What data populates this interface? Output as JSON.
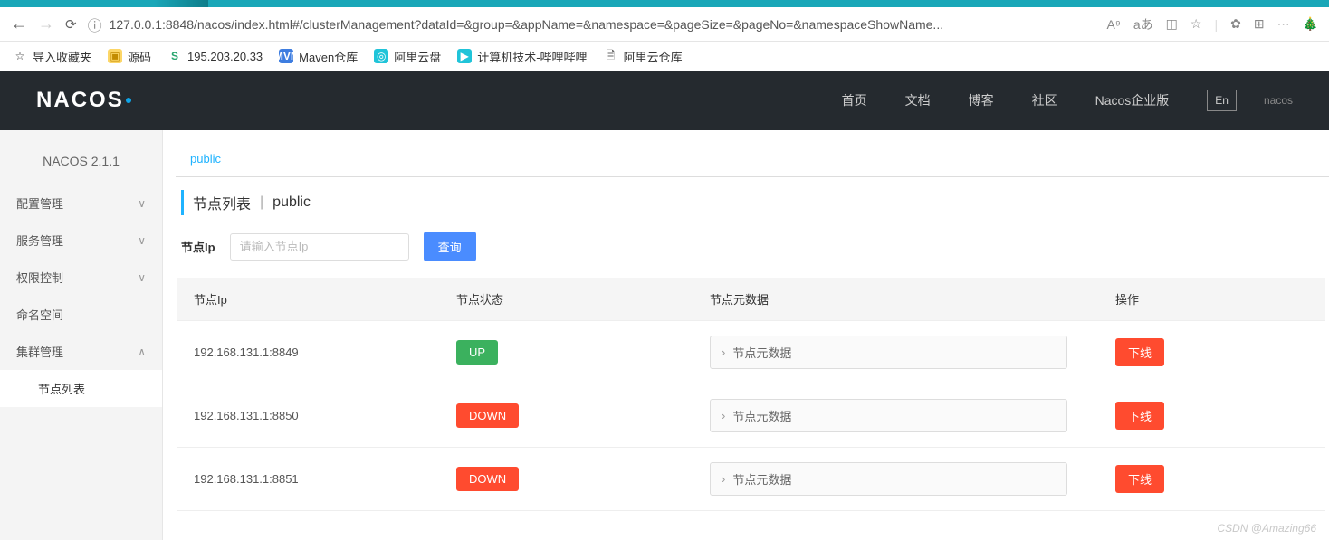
{
  "browser": {
    "url": "127.0.0.1:8848/nacos/index.html#/clusterManagement?dataId=&group=&appName=&namespace=&pageSize=&pageNo=&namespaceShowName...",
    "action_a": "A⁹",
    "action_trans": "aあ",
    "bookmarks": [
      {
        "icon": "star",
        "label": "导入收藏夹"
      },
      {
        "icon": "fold",
        "label": "源码"
      },
      {
        "icon": "green",
        "label": "195.203.20.33"
      },
      {
        "icon": "blue",
        "label": "Maven仓库",
        "badge": "MVN"
      },
      {
        "icon": "cyan",
        "label": "阿里云盘",
        "badge": "◎"
      },
      {
        "icon": "cyan",
        "label": "计算机技术-哔哩哔哩",
        "badge": "▶"
      },
      {
        "icon": "doc",
        "label": "阿里云仓库"
      }
    ]
  },
  "header": {
    "links": [
      "首页",
      "文档",
      "博客",
      "社区",
      "Nacos企业版"
    ],
    "lang": "En",
    "extra": "nacos"
  },
  "sidebar": {
    "title": "NACOS 2.1.1",
    "items": [
      {
        "label": "配置管理",
        "caret": "∨"
      },
      {
        "label": "服务管理",
        "caret": "∨"
      },
      {
        "label": "权限控制",
        "caret": "∨"
      },
      {
        "label": "命名空间",
        "caret": ""
      },
      {
        "label": "集群管理",
        "caret": "∧"
      }
    ],
    "sub": "节点列表"
  },
  "main": {
    "namespace": "public",
    "title": "节点列表",
    "separator": "|",
    "title_ns": "public",
    "search_label": "节点Ip",
    "search_placeholder": "请输入节点Ip",
    "search_btn": "查询",
    "columns": [
      "节点Ip",
      "节点状态",
      "节点元数据",
      "操作"
    ],
    "meta_btn": "节点元数据",
    "rows": [
      {
        "ip": "192.168.131.1:8849",
        "status": "UP",
        "status_cls": "up",
        "action": "下线"
      },
      {
        "ip": "192.168.131.1:8850",
        "status": "DOWN",
        "status_cls": "down",
        "action": "下线"
      },
      {
        "ip": "192.168.131.1:8851",
        "status": "DOWN",
        "status_cls": "down",
        "action": "下线"
      }
    ]
  },
  "watermark": "CSDN @Amazing66"
}
